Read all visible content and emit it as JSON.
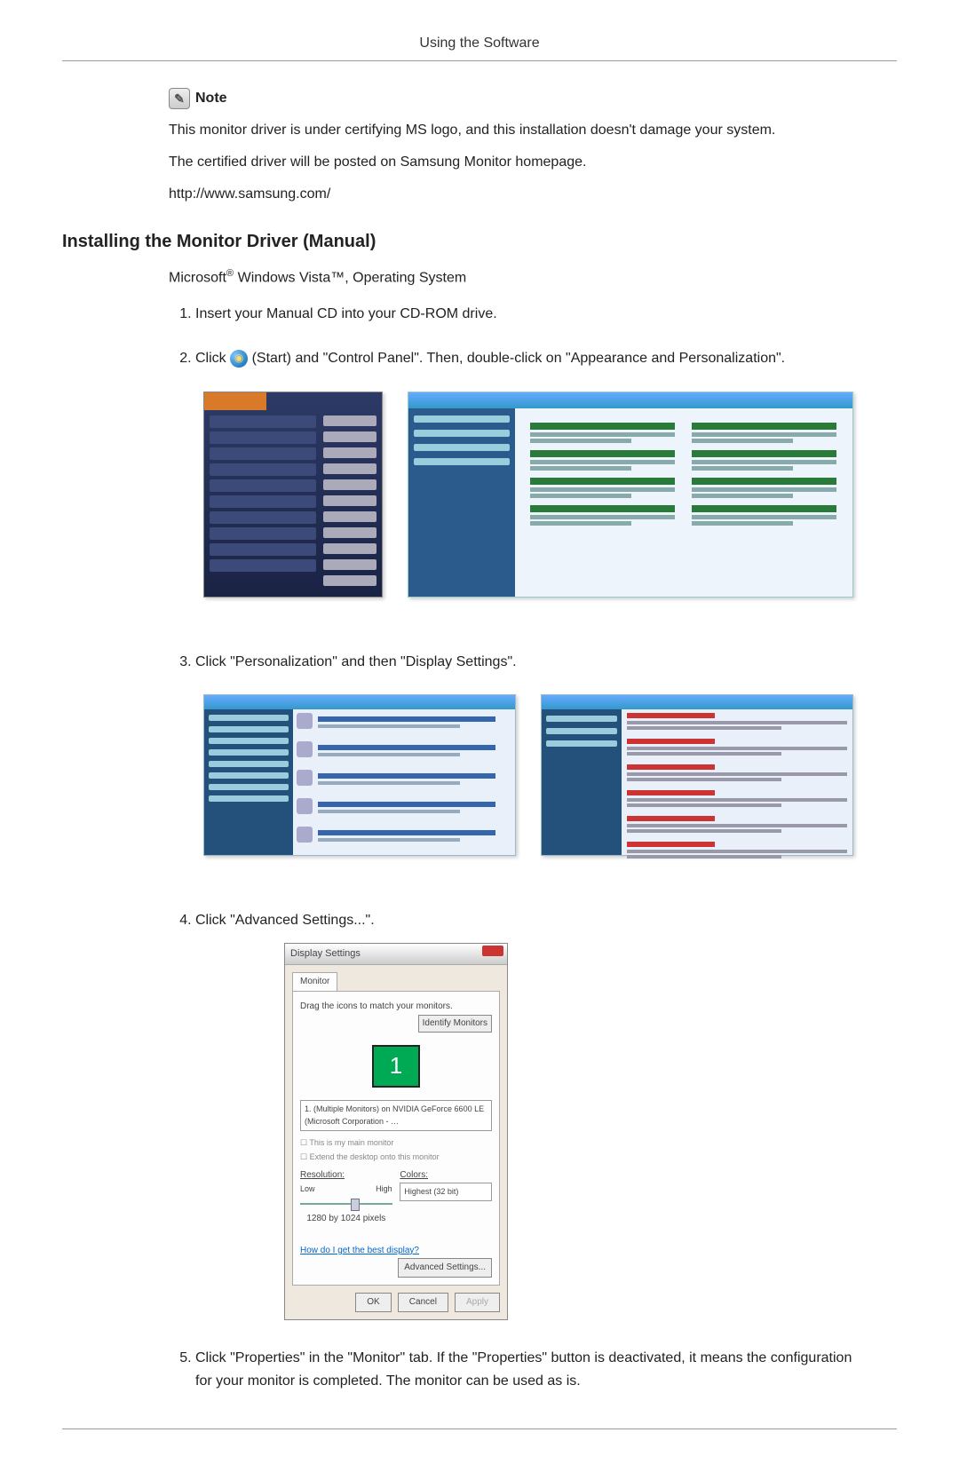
{
  "header": {
    "title": "Using the Software"
  },
  "note": {
    "label": "Note",
    "lines": [
      "This monitor driver is under certifying MS logo, and this installation doesn't damage your system.",
      "The certified driver will be posted on Samsung Monitor homepage.",
      "http://www.samsung.com/"
    ]
  },
  "section": {
    "title": "Installing the Monitor Driver (Manual)",
    "subtitle_pre": "Microsoft",
    "subtitle_reg": "®",
    "subtitle_mid": " Windows Vista™, Operating System"
  },
  "steps": {
    "s1": "Insert your Manual CD into your CD-ROM drive.",
    "s2_a": "Click ",
    "s2_b": "(Start) and \"Control Panel\". Then, double-click on \"Appearance and Personalization\".",
    "s3": "Click \"Personalization\" and then \"Display Settings\".",
    "s4": "Click \"Advanced Settings...\".",
    "s5": "Click \"Properties\" in the \"Monitor\" tab. If the \"Properties\" button is deactivated, it means the configuration for your monitor is completed. The monitor can be used as is."
  },
  "display_settings": {
    "window_title": "Display Settings",
    "tab": "Monitor",
    "drag_text": "Drag the icons to match your monitors.",
    "identify": "Identify Monitors",
    "monitor_number": "1",
    "dropdown": "1. (Multiple Monitors) on NVIDIA GeForce 6600 LE (Microsoft Corporation - …",
    "chk1": "This is my main monitor",
    "chk2": "Extend the desktop onto this monitor",
    "resolution_label": "Resolution:",
    "low": "Low",
    "high": "High",
    "current_res": "1280 by 1024 pixels",
    "colors_label": "Colors:",
    "colors_value": "Highest (32 bit)",
    "help_link": "How do I get the best display?",
    "advanced": "Advanced Settings...",
    "ok": "OK",
    "cancel": "Cancel",
    "apply": "Apply"
  }
}
